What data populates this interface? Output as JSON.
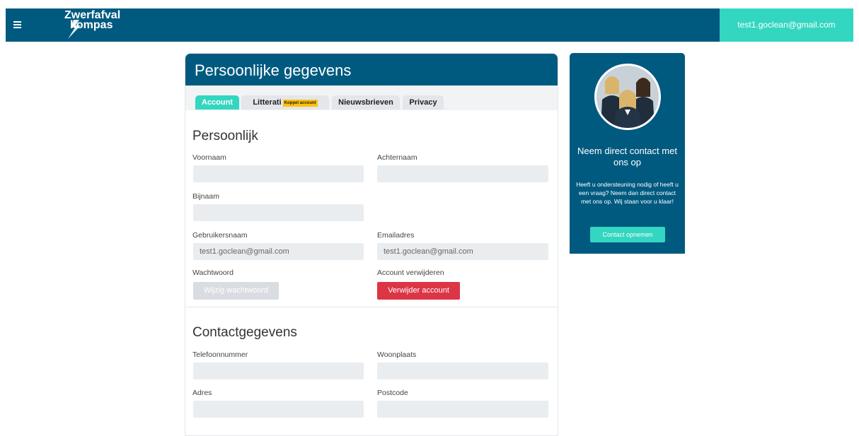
{
  "header": {
    "menu_icon": "hamburger-icon",
    "logo_line1": "Zwerfafval",
    "logo_line2": "kompas",
    "user_email": "test1.goclean@gmail.com"
  },
  "card": {
    "title": "Persoonlijke gegevens",
    "tabs": [
      {
        "label": "Account",
        "active": true
      },
      {
        "label": "Litterati",
        "badge": "Koppel account"
      },
      {
        "label": "Nieuwsbrieven"
      },
      {
        "label": "Privacy"
      }
    ],
    "personal": {
      "title": "Persoonlijk",
      "first_name_label": "Voornaam",
      "first_name_value": "",
      "last_name_label": "Achternaam",
      "last_name_value": "",
      "nickname_label": "Bijnaam",
      "nickname_value": "",
      "username_label": "Gebruikersnaam",
      "username_value": "test1.goclean@gmail.com",
      "email_label": "Emailadres",
      "email_value": "test1.goclean@gmail.com",
      "password_label": "Wachtwoord",
      "password_button": "Wijzig wachtwoord",
      "delete_label": "Account verwijderen",
      "delete_button": "Verwijder account"
    },
    "contact": {
      "title": "Contactgegevens",
      "phone_label": "Telefoonnummer",
      "phone_value": "",
      "city_label": "Woonplaats",
      "city_value": "",
      "address_label": "Adres",
      "address_value": "",
      "postcode_label": "Postcode",
      "postcode_value": ""
    }
  },
  "sidebar": {
    "title": "Neem direct contact met ons op",
    "text": "Heeft u ondersteuning nodig of heeft u een vraag? Neem dan direct contact met ons op. Wij staan voor u klaar!",
    "button": "Contact opnemen"
  },
  "colors": {
    "brand": "#005a80",
    "accent": "#33d6c0",
    "danger": "#dc3545",
    "badge": "#ffc107"
  }
}
